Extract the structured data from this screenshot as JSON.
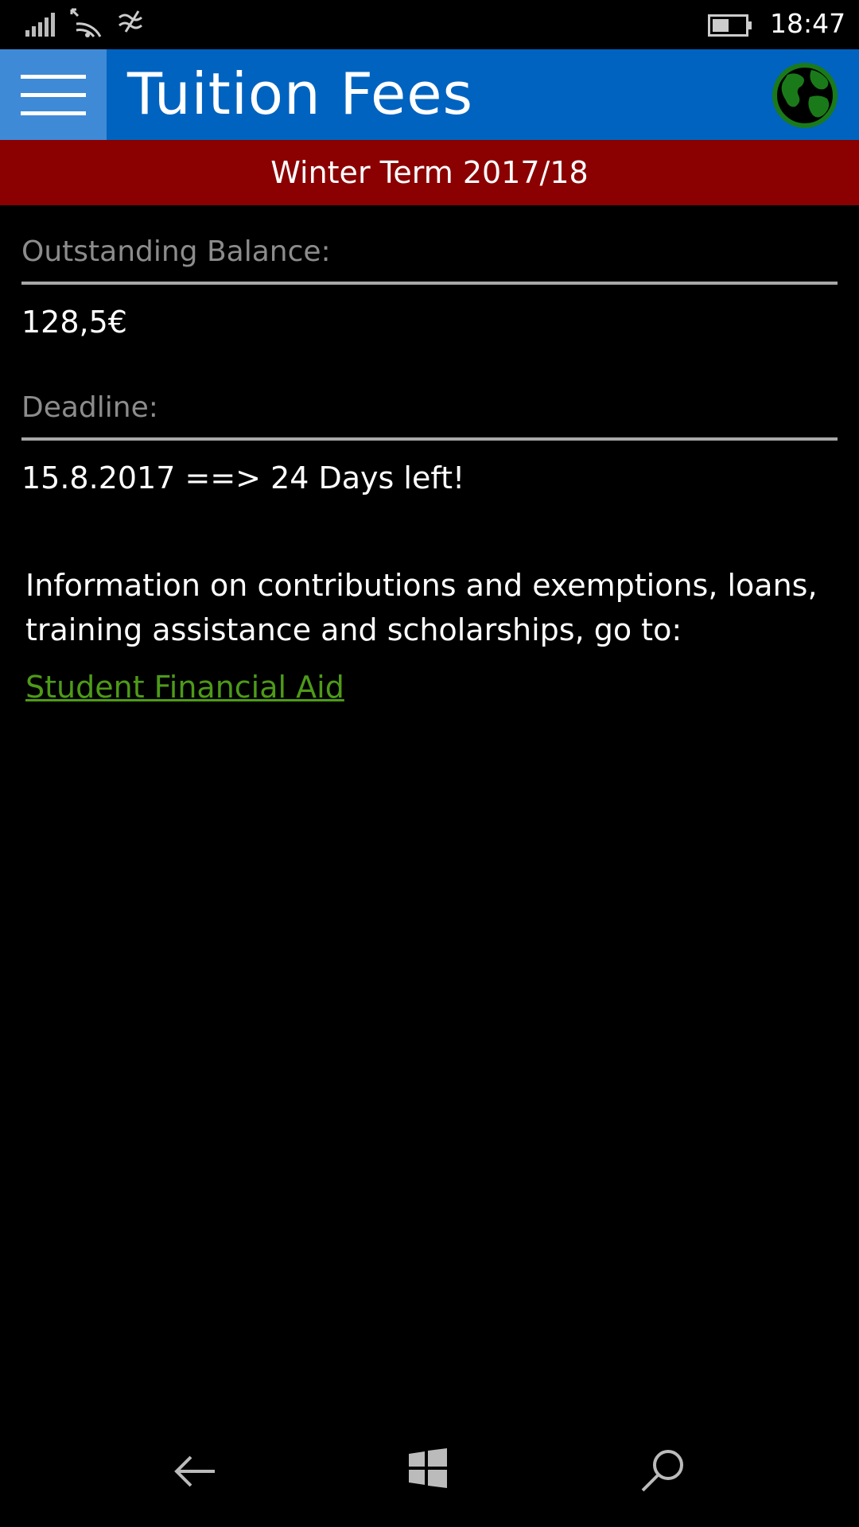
{
  "statusbar": {
    "time": "18:47",
    "icons": [
      "signal-icon",
      "wifi-icon",
      "data-connection-icon",
      "battery-icon"
    ]
  },
  "header": {
    "title": "Tuition Fees",
    "menu_icon": "hamburger-menu-icon",
    "globe_icon": "globe-icon",
    "colors": {
      "bar": "#0063c0",
      "menu_button": "#3f8ad6",
      "globe": "#1a7a1a"
    }
  },
  "term": {
    "label": "Winter Term 2017/18",
    "color": "#8b0000"
  },
  "balance": {
    "label": "Outstanding Balance:",
    "value": "128,5€"
  },
  "deadline": {
    "label": "Deadline:",
    "value": "15.8.2017 ==> 24 Days left!"
  },
  "info": {
    "text": "Information on contributions and exemptions, loans, training assistance and scholarships, go to:",
    "link_label": "Student Financial Aid",
    "link_color": "#4e9a18"
  },
  "navbar": {
    "icons": [
      "back-arrow-icon",
      "windows-start-icon",
      "search-icon"
    ]
  }
}
